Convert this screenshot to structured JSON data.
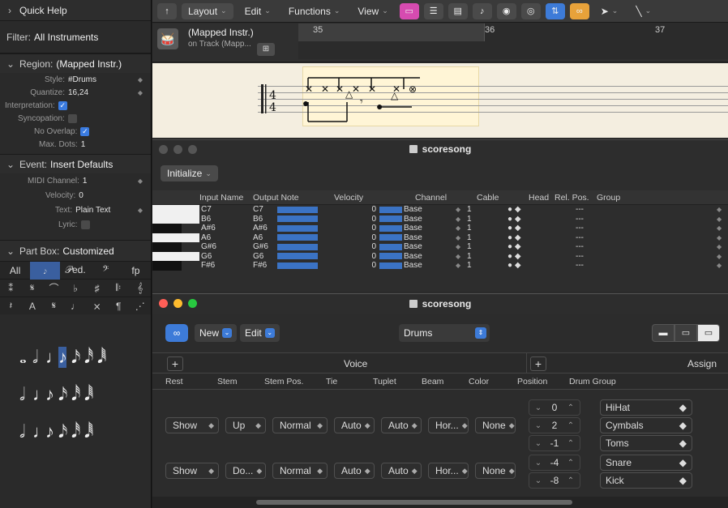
{
  "inspector": {
    "quick_help": "Quick Help",
    "filter_label": "Filter:",
    "filter_value": "All Instruments",
    "region_label": "Region:",
    "region_value": "(Mapped Instr.)",
    "region_props": {
      "style_label": "Style:",
      "style_value": "#Drums",
      "quantize_label": "Quantize:",
      "quantize_value": "16,24",
      "interpretation_label": "Interpretation:",
      "syncopation_label": "Syncopation:",
      "no_overlap_label": "No Overlap:",
      "max_dots_label": "Max. Dots:",
      "max_dots_value": "1"
    },
    "event_label": "Event:",
    "event_value": "Insert Defaults",
    "event_props": {
      "midi_channel_label": "MIDI Channel:",
      "midi_channel_value": "1",
      "velocity_label": "Velocity:",
      "velocity_value": "0",
      "text_label": "Text:",
      "text_value": "Plain Text",
      "lyric_label": "Lyric:"
    },
    "partbox_label": "Part Box:",
    "partbox_value": "Customized",
    "partbox_tabs": [
      "All",
      "𝆕",
      "𝒫ed.",
      "𝄢",
      "fp"
    ]
  },
  "toolbar": {
    "layout": "Layout",
    "edit": "Edit",
    "functions": "Functions",
    "view": "View"
  },
  "track": {
    "region_name": "(Mapped Instr.)",
    "region_sub": "on Track (Mapp...",
    "bars": [
      "35",
      "36",
      "37"
    ]
  },
  "win1": {
    "title": "scoresong",
    "initialize": "Initialize",
    "columns": [
      "Input Name",
      "Output Note",
      "Velocity",
      "Channel",
      "Cable",
      "Head",
      "Rel. Pos.",
      "Group"
    ],
    "rows": [
      {
        "in": "C7",
        "out": "C7",
        "vel": "0",
        "ch": "Base",
        "cable": "1",
        "grp": "---"
      },
      {
        "in": "B6",
        "out": "B6",
        "vel": "0",
        "ch": "Base",
        "cable": "1",
        "grp": "---"
      },
      {
        "in": "A#6",
        "out": "A#6",
        "vel": "0",
        "ch": "Base",
        "cable": "1",
        "grp": "---"
      },
      {
        "in": "A6",
        "out": "A6",
        "vel": "0",
        "ch": "Base",
        "cable": "1",
        "grp": "---"
      },
      {
        "in": "G#6",
        "out": "G#6",
        "vel": "0",
        "ch": "Base",
        "cable": "1",
        "grp": "---"
      },
      {
        "in": "G6",
        "out": "G6",
        "vel": "0",
        "ch": "Base",
        "cable": "1",
        "grp": "---"
      },
      {
        "in": "F#6",
        "out": "F#6",
        "vel": "0",
        "ch": "Base",
        "cable": "1",
        "grp": "---"
      }
    ]
  },
  "win2": {
    "title": "scoresong",
    "new_label": "New",
    "edit_label": "Edit",
    "drum_set": "Drums",
    "voice_title": "Voice",
    "assign_title": "Assign",
    "voice_columns": [
      "Rest",
      "Stem",
      "Stem Pos.",
      "Tie",
      "Tuplet",
      "Beam",
      "Color"
    ],
    "assign_columns": [
      "Position",
      "Drum Group"
    ],
    "voices": [
      {
        "rest": "Show",
        "stem": "Up",
        "stem_pos": "Normal",
        "tie": "Auto",
        "tuplet": "Auto",
        "beam": "Hor...",
        "color": "None"
      },
      {
        "rest": "Show",
        "stem": "Do...",
        "stem_pos": "Normal",
        "tie": "Auto",
        "tuplet": "Auto",
        "beam": "Hor...",
        "color": "None"
      }
    ],
    "assign": [
      {
        "pos": "0",
        "group": "HiHat"
      },
      {
        "pos": "2",
        "group": "Cymbals"
      },
      {
        "pos": "-1",
        "group": "Toms"
      },
      {
        "pos": "-4",
        "group": "Snare"
      },
      {
        "pos": "-8",
        "group": "Kick"
      }
    ]
  }
}
